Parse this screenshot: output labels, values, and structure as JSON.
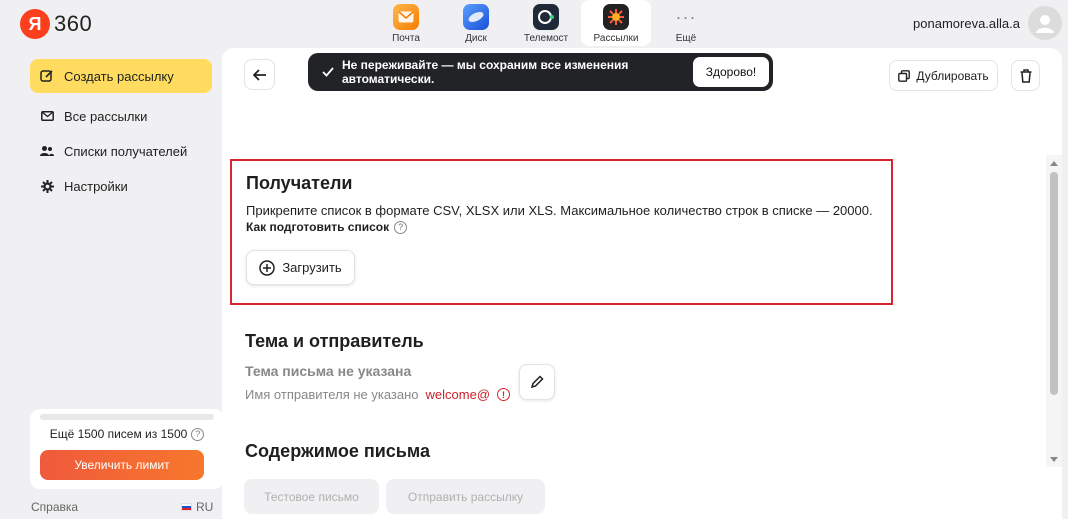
{
  "header": {
    "logo_letter": "Я",
    "logo_text": "360",
    "apps": [
      {
        "label": "Почта",
        "icon": "mail-icon"
      },
      {
        "label": "Диск",
        "icon": "disk-icon"
      },
      {
        "label": "Телемост",
        "icon": "telemost-icon"
      },
      {
        "label": "Рассылки",
        "icon": "mailings-icon",
        "active": true
      },
      {
        "label": "Ещё",
        "icon": "more-icon"
      }
    ],
    "user_name": "ponamoreva.alla.a"
  },
  "sidebar": {
    "create_label": "Создать рассылку",
    "items": [
      {
        "label": "Все рассылки",
        "icon": "envelope-icon"
      },
      {
        "label": "Списки получателей",
        "icon": "people-icon"
      },
      {
        "label": "Настройки",
        "icon": "gear-icon"
      }
    ],
    "limit_text": "Ещё 1500 писем из 1500",
    "limit_button": "Увеличить лимит",
    "help": "Справка",
    "lang": "RU"
  },
  "toolbar": {
    "duplicate_label": "Дублировать"
  },
  "toast": {
    "message": "Не переживайте — мы сохраним все изменения автоматически.",
    "button": "Здорово!"
  },
  "recipients": {
    "title": "Получатели",
    "description": "Прикрепите список в формате CSV, XLSX или XLS. Максимальное количество строк в списке — 20000.",
    "howto": "Как подготовить список",
    "upload_label": "Загрузить"
  },
  "subject": {
    "title": "Тема и отправитель",
    "empty_subject": "Тема письма не указана",
    "sender_label": "Имя отправителя не указано",
    "sender_email": "welcome@"
  },
  "content": {
    "title": "Содержимое письма",
    "test_button": "Тестовое письмо",
    "send_button": "Отправить рассылку"
  },
  "colors": {
    "accent_yellow": "#ffdc60",
    "brand_red": "#fc3f1d",
    "highlight_border": "#d7262f",
    "limit_button": "#f26a33"
  }
}
